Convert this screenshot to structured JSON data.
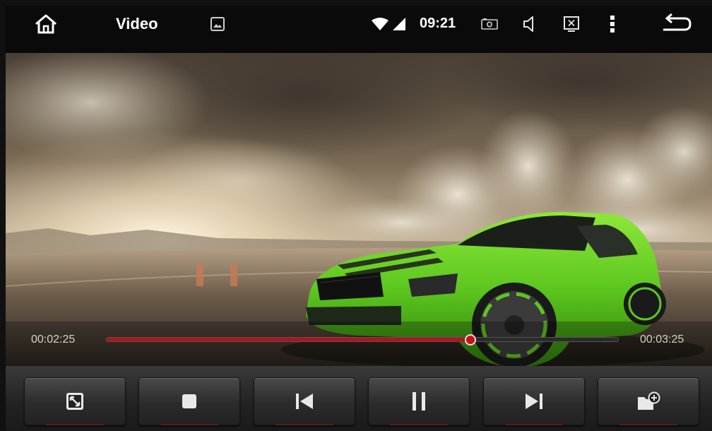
{
  "status_bar": {
    "app_title": "Video",
    "clock": "09:21",
    "icons": [
      "home-icon",
      "gallery-icon",
      "wifi-icon",
      "signal-icon",
      "screenshot-icon",
      "volume-icon",
      "close-window-icon",
      "overflow-menu-icon",
      "back-icon"
    ]
  },
  "player": {
    "elapsed": "00:02:25",
    "total": "00:03:25",
    "progress_fraction": 0.71,
    "progress_color": "#b3121e"
  },
  "controls": [
    "fullscreen-icon",
    "stop-icon",
    "previous-icon",
    "pause-icon",
    "next-icon",
    "add-to-playlist-icon"
  ]
}
